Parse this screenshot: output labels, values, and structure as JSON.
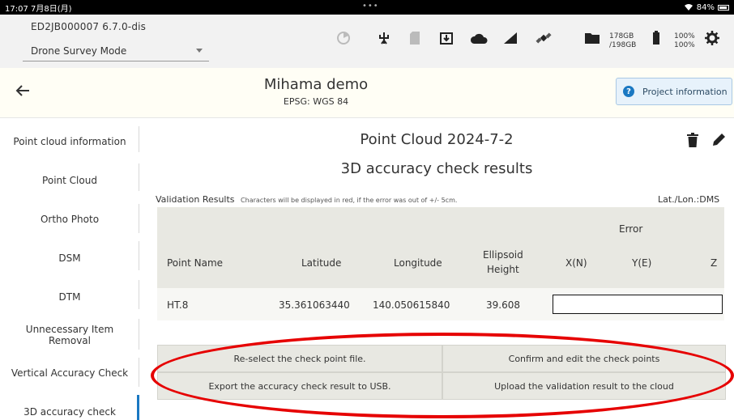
{
  "status_bar": {
    "time_date": "17:07  7月8日(月)",
    "battery": "84%"
  },
  "toolbar": {
    "device_id": "ED2JB000007    6.7.0-dis",
    "mode": "Drone Survey Mode",
    "icons": [
      "timer-icon",
      "antenna-icon",
      "sd-card-icon",
      "download-box-icon",
      "cloud-icon",
      "signal-icon",
      "satellite-icon",
      "folder-icon",
      "battery-icon",
      "gear-icon"
    ],
    "storage_line1": "178GB",
    "storage_line2": "/198GB",
    "battery_line1": "100%",
    "battery_line2": "100%"
  },
  "header": {
    "project_name": "Mihama demo",
    "epsg": "EPSG: WGS 84",
    "project_info_label": "Project information"
  },
  "sidebar": {
    "items": [
      "Point cloud information",
      "Point Cloud",
      "Ortho Photo",
      "DSM",
      "DTM",
      "Unnecessary Item Removal",
      "Vertical Accuracy Check",
      "3D accuracy check"
    ],
    "unnecessary_line1": "Unnecessary Item",
    "unnecessary_line2": "Removal",
    "active": "3D accuracy check"
  },
  "main": {
    "point_cloud_title": "Point Cloud 2024-7-2",
    "check_title": "3D accuracy check results",
    "validation_label": "Validation Results",
    "validation_note": "Characters will be displayed in red, if the error was out of +/- 5cm.",
    "coord_format": "Lat./Lon.:DMS",
    "table": {
      "error_group": "Error",
      "columns": [
        "Point Name",
        "Latitude",
        "Longitude",
        "Ellipsoid Height",
        "X(N)",
        "Y(E)",
        "Z"
      ],
      "ellipsoid_line1": "Ellipsoid",
      "ellipsoid_line2": "Height",
      "rows": [
        {
          "point_name": "HT.8",
          "latitude": "35.361063440",
          "longitude": "140.050615840",
          "ellipsoid_height": "39.608"
        }
      ]
    },
    "buttons": {
      "reselect": "Re-select the check point file.",
      "confirm_edit": "Confirm and edit the check points",
      "export_usb": "Export the accuracy check result to USB.",
      "upload_cloud": "Upload the validation result to the cloud"
    }
  },
  "colors": {
    "accent": "#1a78c2",
    "highlight_ellipse": "#e60000",
    "header_bg": "#fffef5",
    "table_bg": "#e8e8e2"
  }
}
